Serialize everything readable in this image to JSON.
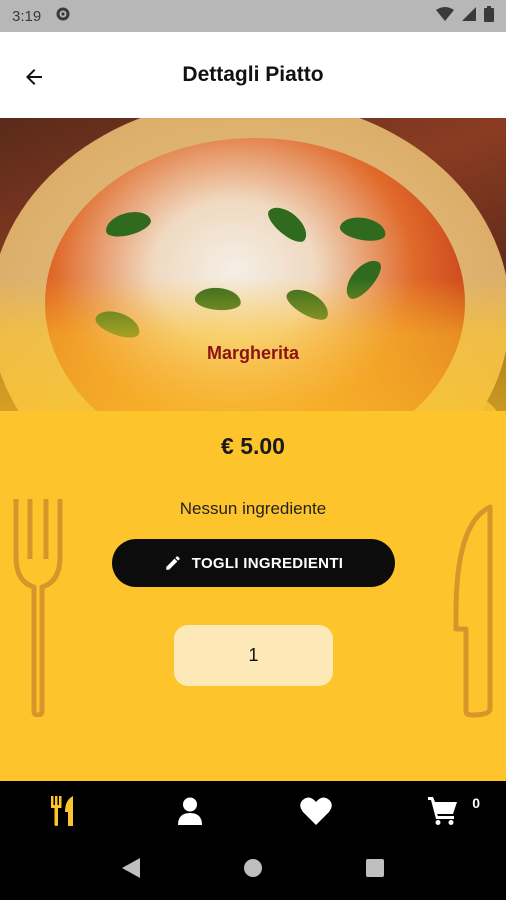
{
  "status_bar": {
    "time": "3:19"
  },
  "app_bar": {
    "title": "Dettagli Piatto"
  },
  "dish": {
    "name": "Margherita",
    "price": "€ 5.00",
    "ingredients_text": "Nessun ingrediente",
    "remove_button_label": "TOGLI INGREDIENTI",
    "quantity": "1"
  },
  "bottom_nav": {
    "items": [
      "menu-icon",
      "profile-icon",
      "favorites-icon",
      "cart-icon"
    ],
    "cart_count": "0"
  },
  "colors": {
    "accent_yellow": "#fdc42c",
    "dish_name": "#8a1414",
    "nav_active": "#fdc42c"
  }
}
